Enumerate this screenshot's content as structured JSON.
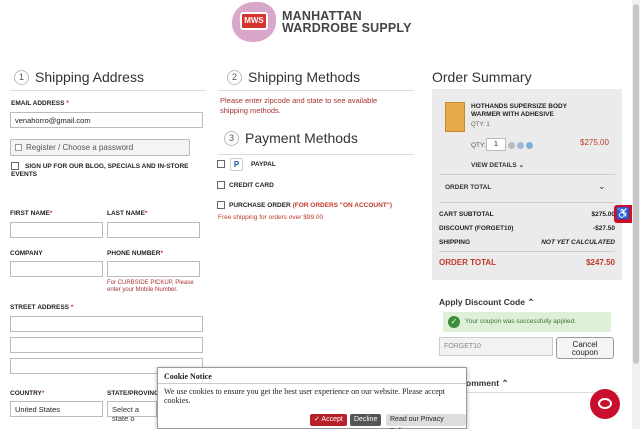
{
  "brand": {
    "line1": "MANHATTAN",
    "line2": "WARDROBE SUPPLY",
    "badge": "MWS"
  },
  "shipping_address": {
    "step": "1",
    "title": "Shipping Address",
    "email_label": "EMAIL ADDRESS",
    "email_value": "venahorro@gmail.com",
    "register_label": "Register / Choose a password",
    "newsletter_label": "SIGN UP FOR OUR BLOG, SPECIALS AND IN-STORE EVENTS",
    "first_name_label": "FIRST NAME",
    "last_name_label": "LAST NAME",
    "company_label": "COMPANY",
    "phone_label": "PHONE NUMBER",
    "phone_hint": "For CURBSIDE PICKUP, Please enter your Mobile Number.",
    "street_label": "STREET ADDRESS",
    "country_label": "COUNTRY",
    "country_value": "United States",
    "state_label": "STATE/PROVINCE",
    "state_placeholder": "Select a state o"
  },
  "shipping_methods": {
    "step": "2",
    "title": "Shipping Methods",
    "warning": "Please enter zipcode and state to see available shipping methods."
  },
  "payment_methods": {
    "step": "3",
    "title": "Payment Methods",
    "paypal": "PAYPAL",
    "credit_card": "CREDIT CARD",
    "purchase_order": "PURCHASE ORDER",
    "purchase_order_note": "(FOR ORDERS \"ON ACCOUNT\")",
    "free_shipping": "Free shipping for orders over $99.00"
  },
  "order_summary": {
    "title": "Order Summary",
    "product_name": "HOTHANDS SUPERSIZE BODY WARMER WITH ADHESIVE",
    "product_qty_text": "QTY: 1",
    "qty_label": "QTY:",
    "qty_value": "1",
    "price": "$275.00",
    "view_details": "VIEW DETAILS",
    "order_total_header": "ORDER TOTAL",
    "rows": [
      {
        "label": "CART SUBTOTAL",
        "value": "$275.00"
      },
      {
        "label": "DISCOUNT (FORGET10)",
        "value": "-$27.50"
      },
      {
        "label": "SHIPPING",
        "value": "NOT YET CALCULATED"
      }
    ],
    "total_label": "ORDER TOTAL",
    "total_value": "$247.50"
  },
  "discount": {
    "title": "Apply Discount Code",
    "success": "Your coupon was successfully applied.",
    "code": "FORGET10",
    "cancel_line1": "Cancel",
    "cancel_line2": "coupon"
  },
  "comment": {
    "title": "omment"
  },
  "cookie": {
    "title": "Cookie Notice",
    "text": "We use cookies to ensure you get the best user experience on our website. Please accept cookies.",
    "accept": "✓ Accept",
    "decline": "Decline",
    "privacy": "Read our Privacy Policy"
  },
  "colors": {
    "accent": "#c8102e",
    "warning": "#a33333",
    "success_bg": "#dff0d8"
  }
}
